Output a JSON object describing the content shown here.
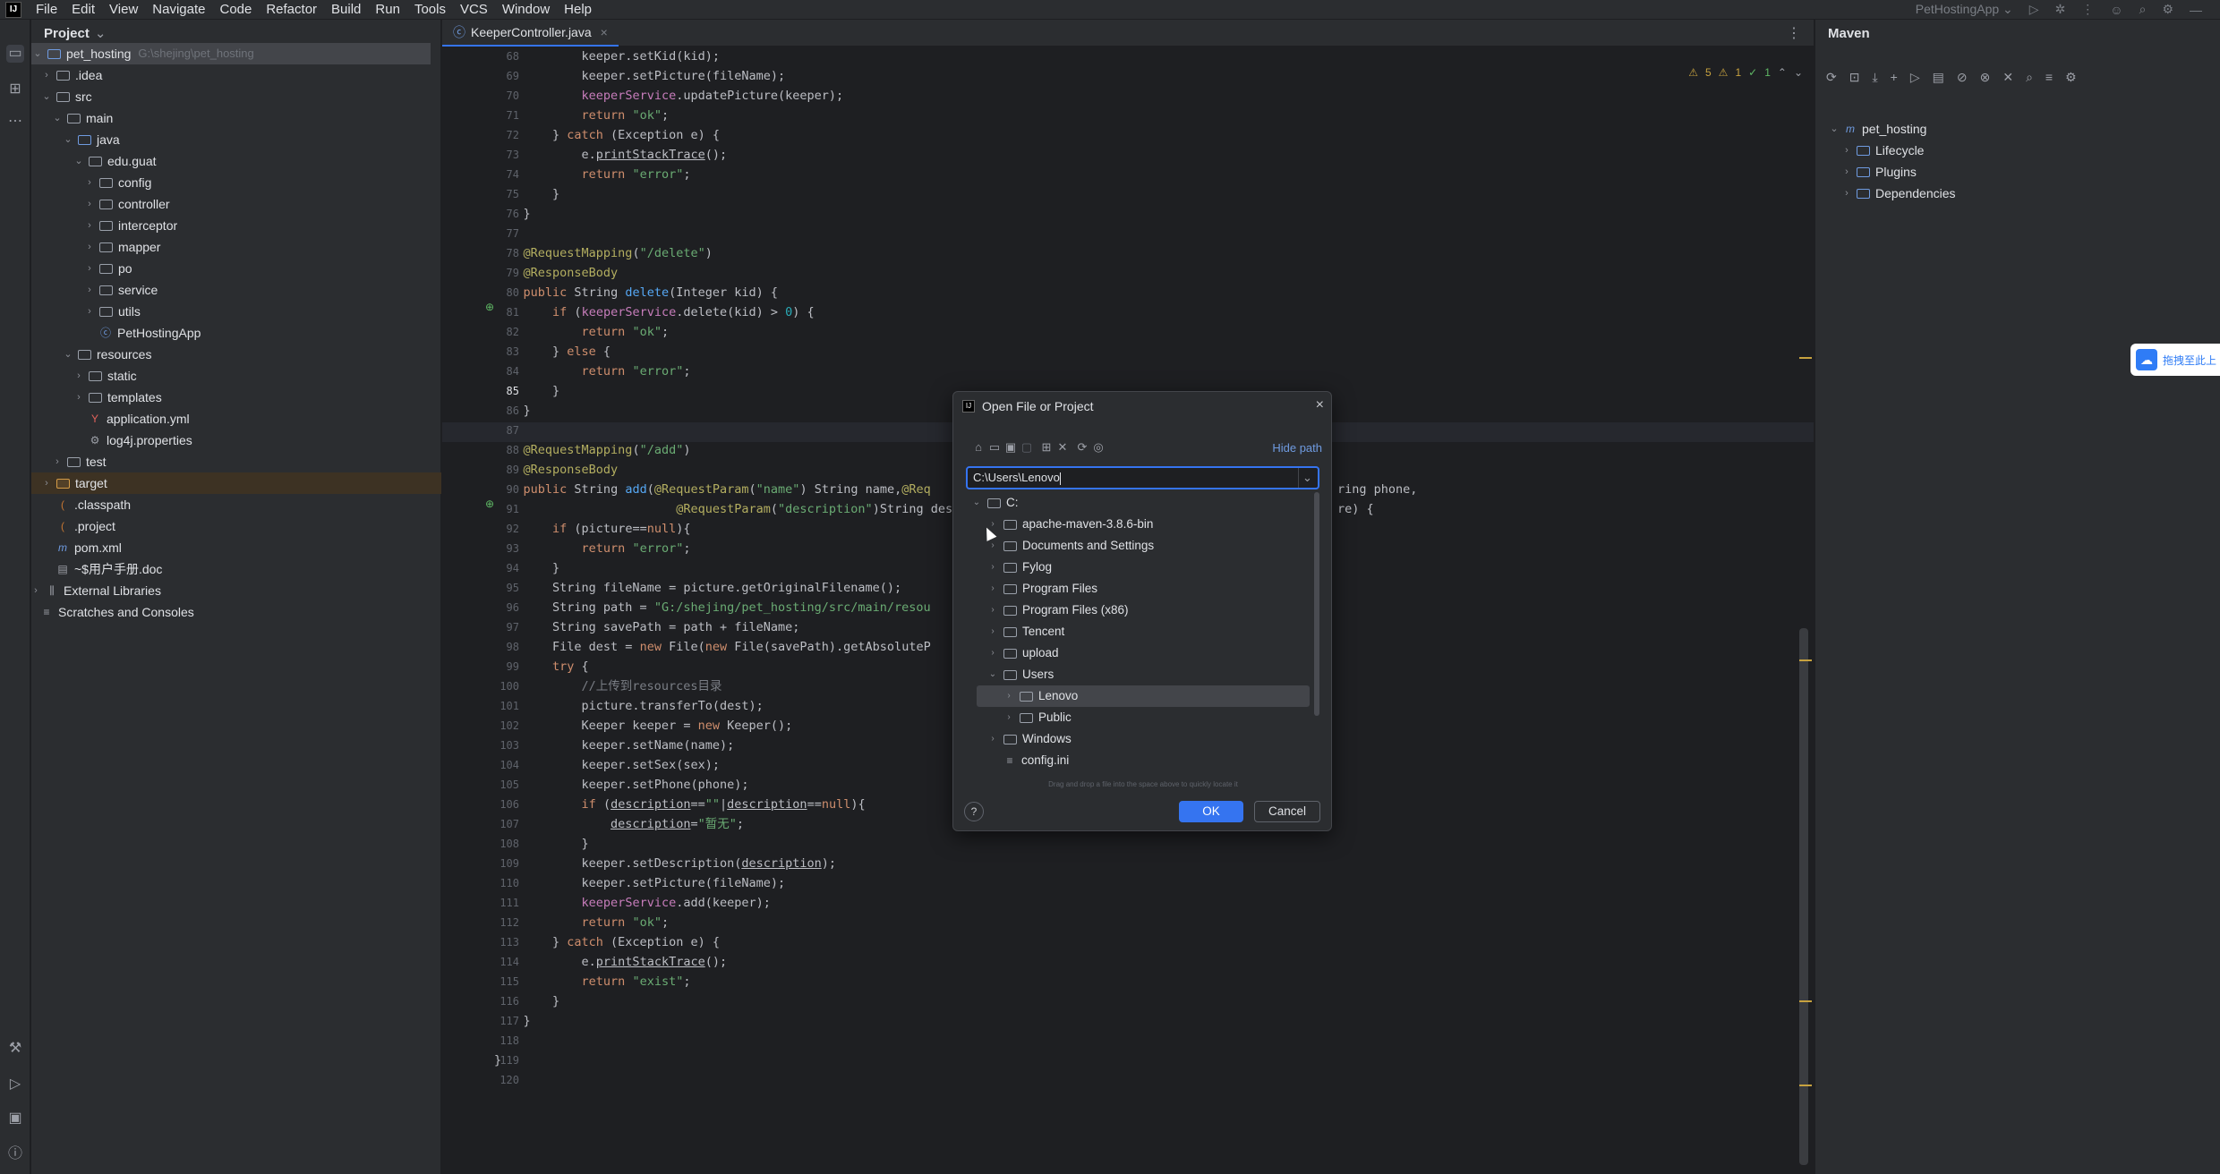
{
  "menu": [
    "File",
    "Edit",
    "View",
    "Navigate",
    "Code",
    "Refactor",
    "Build",
    "Run",
    "Tools",
    "VCS",
    "Window",
    "Help"
  ],
  "run_config": "PetHostingApp",
  "project_panel": {
    "title": "Project",
    "root_name": "pet_hosting",
    "root_path": "G:\\shejing\\pet_hosting",
    "items": [
      ".idea",
      "src",
      "main",
      "java",
      "edu.guat",
      "config",
      "controller",
      "interceptor",
      "mapper",
      "po",
      "service",
      "utils",
      "PetHostingApp",
      "resources",
      "static",
      "templates",
      "application.yml",
      "log4j.properties",
      "test",
      "target",
      ".classpath",
      ".project",
      "pom.xml",
      "~$用户手册.doc",
      "External Libraries",
      "Scratches and Consoles"
    ]
  },
  "editor": {
    "tab": "KeeperController.java",
    "inspections": {
      "warnings": "5",
      "weak": "1",
      "ok": "1"
    },
    "lines": [
      "68",
      "69",
      "70",
      "71",
      "72",
      "73",
      "74",
      "75",
      "76",
      "77",
      "78",
      "79",
      "80",
      "81",
      "82",
      "83",
      "84",
      "85",
      "86",
      "87",
      "88",
      "89",
      "90",
      "91",
      "92",
      "93",
      "94",
      "95",
      "96",
      "97",
      "98",
      "99",
      "100",
      "101",
      "102",
      "103",
      "104",
      "105",
      "106",
      "107",
      "108",
      "109",
      "110",
      "111",
      "112",
      "113",
      "114",
      "115",
      "116",
      "117",
      "118",
      "119",
      "120"
    ]
  },
  "maven": {
    "title": "Maven",
    "project": "pet_hosting",
    "items": [
      "Lifecycle",
      "Plugins",
      "Dependencies"
    ]
  },
  "dialog": {
    "title": "Open File or Project",
    "hide_path": "Hide path",
    "path_value": "C:\\Users\\Lenovo",
    "tree": [
      "C:",
      "apache-maven-3.8.6-bin",
      "Documents and Settings",
      "Fylog",
      "Program Files",
      "Program Files (x86)",
      "Tencent",
      "upload",
      "Users",
      "Lenovo",
      "Public",
      "Windows",
      "config.ini"
    ],
    "hint": "Drag and drop a file into the space above to quickly locate it",
    "ok": "OK",
    "cancel": "Cancel",
    "help": "?"
  },
  "badge": "拖拽至此上"
}
